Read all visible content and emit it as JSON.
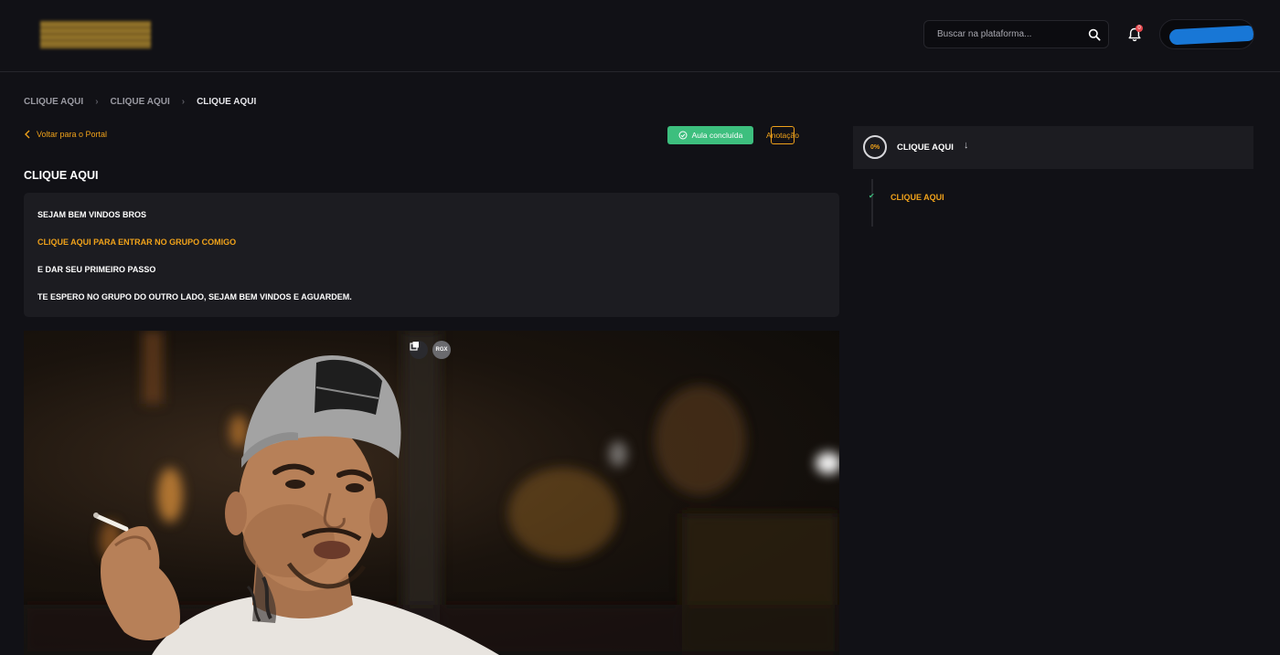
{
  "header": {
    "search_placeholder": "Buscar na plataforma...",
    "notification_count": "0"
  },
  "breadcrumb": [
    {
      "label": "CLIQUE AQUI"
    },
    {
      "label": "CLIQUE AQUI"
    },
    {
      "label": "CLIQUE AQUI"
    }
  ],
  "actions": {
    "back_label": "Voltar para o Portal",
    "done_label": "Aula concluída",
    "note_label": "Anotação"
  },
  "lesson": {
    "title": "CLIQUE AQUI",
    "description": [
      {
        "text": "SEJAM BEM VINDOS BROS",
        "is_link": false
      },
      {
        "text": "CLIQUE AQUI PARA ENTRAR NO GRUPO COMIGO",
        "is_link": true
      },
      {
        "text": "E DAR SEU PRIMEIRO PASSO",
        "is_link": false
      },
      {
        "text": "TE ESPERO NO GRUPO DO OUTRO LADO, SEJAM BEM VINDOS E AGUARDEM.",
        "is_link": false
      }
    ]
  },
  "video": {
    "badge_label": "RGX"
  },
  "sidebar": {
    "progress": "0%",
    "module_title": "CLIQUE AQUI",
    "lessons": [
      {
        "label": "CLIQUE AQUI",
        "completed": true
      }
    ]
  },
  "colors": {
    "background": "#111116",
    "accent": "#f0a21a",
    "success": "#3dbf7e",
    "panel": "#1c1c21"
  }
}
